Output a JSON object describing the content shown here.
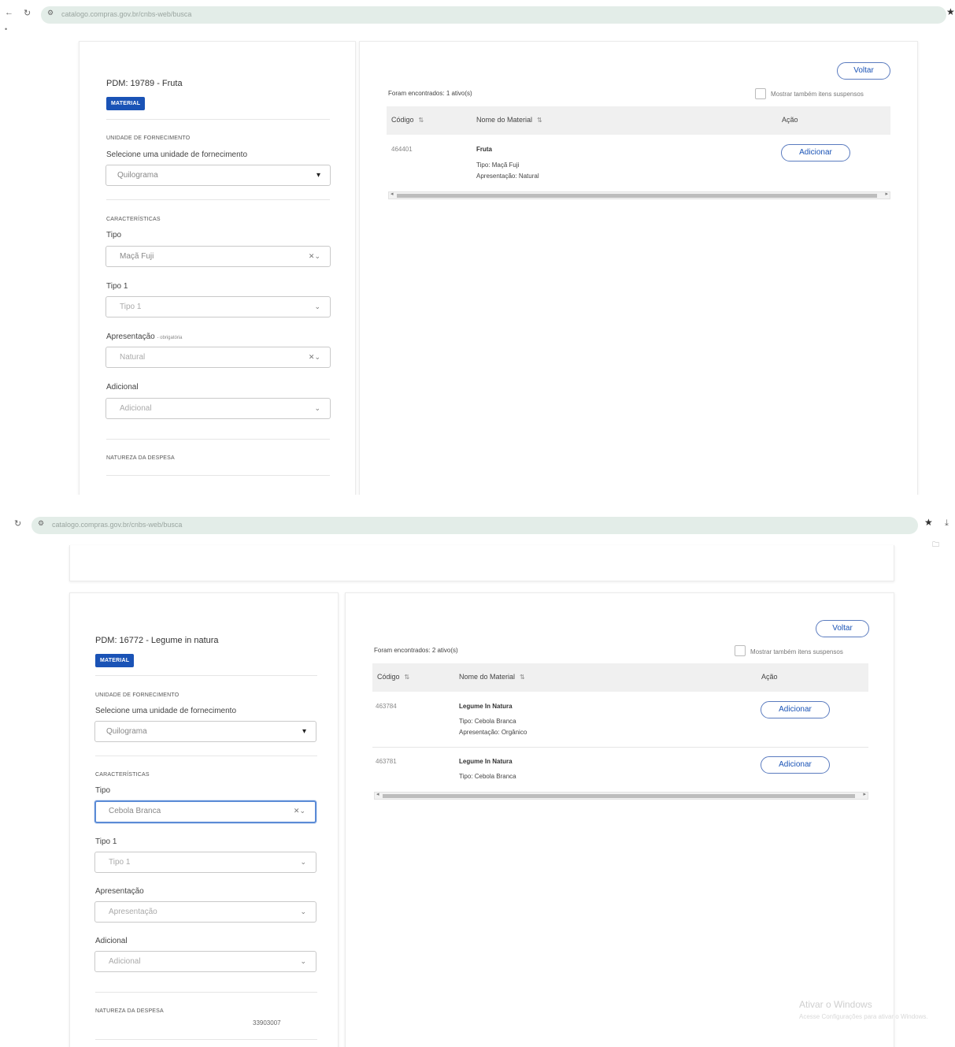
{
  "screenshot_top": {
    "browser": {
      "url": "catalogo.compras.gov.br/cnbs-web/busca"
    },
    "left": {
      "pdm_title": "PDM: 19789 - Fruta",
      "badge": "MATERIAL",
      "unit_section": "UNIDADE DE FORNECIMENTO",
      "unit_label": "Selecione uma unidade de fornecimento",
      "unit_value": "Quilograma",
      "char_section": "CARACTERÍSTICAS",
      "tipo_label": "Tipo",
      "tipo_value": "Maçã Fuji",
      "tipo1_label": "Tipo 1",
      "tipo1_placeholder": "Tipo 1",
      "apresentacao_label": "Apresentação",
      "apresentacao_required": "obrigatória",
      "apresentacao_value": "Natural",
      "adicional_label": "Adicional",
      "adicional_placeholder": "Adicional",
      "natureza_section": "NATUREZA DA DESPESA"
    },
    "right": {
      "voltar": "Voltar",
      "found": "Foram encontrados: 1 ativo(s)",
      "show_suspended": "Mostrar também itens suspensos",
      "col_codigo": "Código",
      "col_nome": "Nome do Material",
      "col_acao": "Ação",
      "rows": [
        {
          "code": "464401",
          "name": "Fruta",
          "line1": "Tipo: Maçã Fuji",
          "line2": "Apresentação: Natural",
          "action": "Adicionar"
        }
      ]
    }
  },
  "screenshot_bottom": {
    "browser": {
      "url": "catalogo.compras.gov.br/cnbs-web/busca"
    },
    "left": {
      "pdm_title": "PDM: 16772 - Legume in natura",
      "badge": "MATERIAL",
      "unit_section": "UNIDADE DE FORNECIMENTO",
      "unit_label": "Selecione uma unidade de fornecimento",
      "unit_value": "Quilograma",
      "char_section": "CARACTERÍSTICAS",
      "tipo_label": "Tipo",
      "tipo_value": "Cebola Branca",
      "tipo1_label": "Tipo 1",
      "tipo1_placeholder": "Tipo 1",
      "apresentacao_label": "Apresentação",
      "apresentacao_placeholder": "Apresentação",
      "adicional_label": "Adicional",
      "adicional_placeholder": "Adicional",
      "natureza_section": "NATUREZA DA DESPESA",
      "natureza_value": "33903007"
    },
    "right": {
      "voltar": "Voltar",
      "found": "Foram encontrados: 2 ativo(s)",
      "show_suspended": "Mostrar também itens suspensos",
      "col_codigo": "Código",
      "col_nome": "Nome do Material",
      "col_acao": "Ação",
      "rows": [
        {
          "code": "463784",
          "name": "Legume In Natura",
          "line1": "Tipo: Cebola Branca",
          "line2": "Apresentação: Orgânico",
          "action": "Adicionar"
        },
        {
          "code": "463781",
          "name": "Legume In Natura",
          "line1": "Tipo: Cebola Branca",
          "action": "Adicionar"
        }
      ]
    },
    "watermark": {
      "title": "Ativar o Windows",
      "subtitle": "Acesse Configurações para ativar o Windows."
    }
  }
}
